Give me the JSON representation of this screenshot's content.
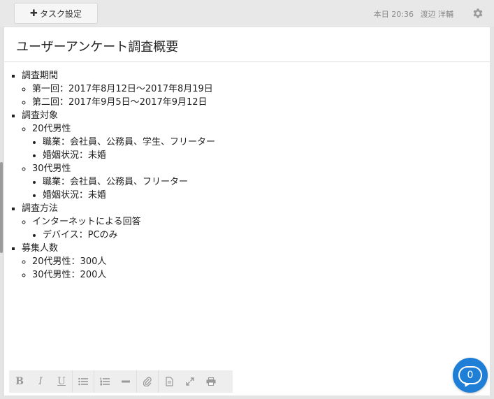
{
  "topbar": {
    "task_settings_label": "タスク設定",
    "date_label": "本日 20:36",
    "user_name": "渡辺 洋輔"
  },
  "document": {
    "title": "ユーザーアンケート調査概要",
    "sections": [
      {
        "label": "調査期間",
        "items": [
          {
            "label": "第一回：2017年8月12日〜2017年8月19日"
          },
          {
            "label": "第二回：2017年9月5日〜2017年9月12日"
          }
        ]
      },
      {
        "label": "調査対象",
        "items": [
          {
            "label": "20代男性",
            "subitems": [
              "職業：会社員、公務員、学生、フリーター",
              "婚姻状況：未婚"
            ]
          },
          {
            "label": "30代男性",
            "subitems": [
              "職業：会社員、公務員、フリーター",
              "婚姻状況：未婚"
            ]
          }
        ]
      },
      {
        "label": "調査方法",
        "items": [
          {
            "label": "インターネットによる回答",
            "subitems": [
              "デバイス：PCのみ"
            ]
          }
        ]
      },
      {
        "label": "募集人数",
        "items": [
          {
            "label": "20代男性：300人"
          },
          {
            "label": "30代男性：200人"
          }
        ]
      }
    ]
  },
  "toolbar": {
    "bold": "B",
    "italic": "I",
    "underline": "U"
  },
  "chat": {
    "unread_count": "0"
  },
  "colors": {
    "accent": "#1f7fd6",
    "background": "#e4e4e4",
    "panel": "#ffffff"
  }
}
